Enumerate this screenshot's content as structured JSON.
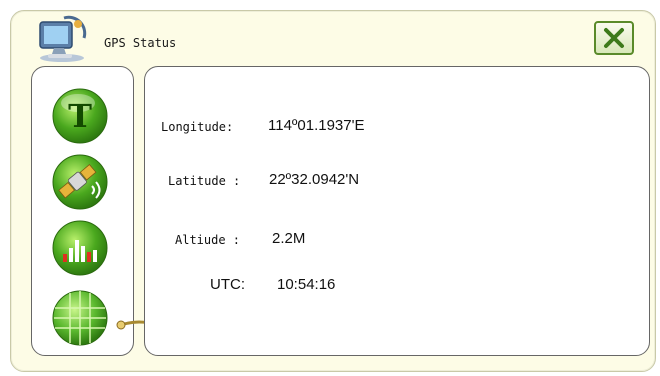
{
  "window": {
    "title": "GPS Status",
    "app_icon": "computer-gps-icon",
    "close_icon": "close-x-icon"
  },
  "sidebar": {
    "buttons": [
      {
        "icon": "text-t-icon",
        "label": "T"
      },
      {
        "icon": "satellite-icon"
      },
      {
        "icon": "signal-bars-icon"
      },
      {
        "icon": "globe-grid-icon"
      }
    ]
  },
  "status": {
    "longitude_label": "Longitude:",
    "longitude_value": "114º01.1937'E",
    "latitude_label": "Latitude :",
    "latitude_value": "22º32.0942'N",
    "altitude_label": "Altiude :",
    "altitude_value": "2.2M",
    "utc_label": "UTC:",
    "utc_value": "10:54:16"
  },
  "colors": {
    "window_bg": "#fdfce6",
    "accent_green": "#3f9a1c",
    "close_border": "#5a8a2a"
  }
}
